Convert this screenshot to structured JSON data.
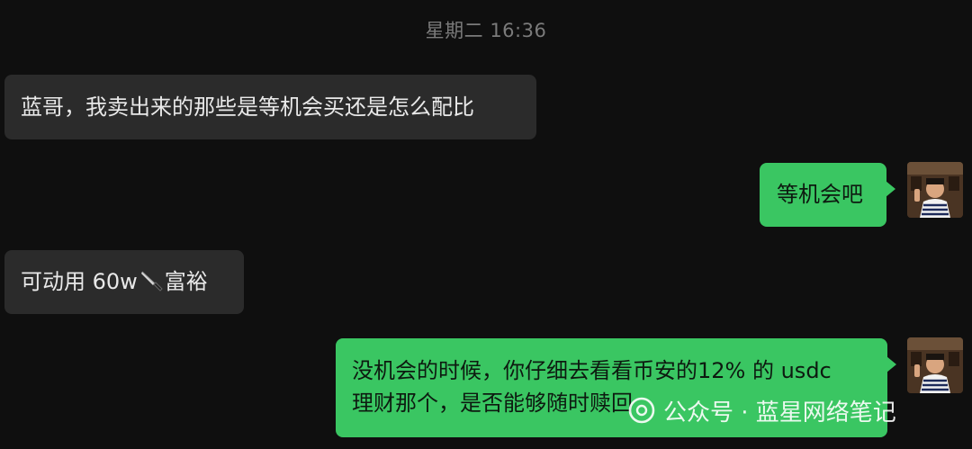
{
  "chat": {
    "timestamp": "星期二 16:36",
    "messages": [
      {
        "side": "left",
        "text": "蓝哥，我卖出来的那些是等机会买还是怎么配比"
      },
      {
        "side": "right",
        "text": "等机会吧"
      },
      {
        "side": "left",
        "text_before": "可动用 60w",
        "icon": "knife-icon",
        "text_after": "富裕"
      },
      {
        "side": "right",
        "line1": "没机会的时候，你仔细去看看币安的12% 的 usdc",
        "line2": "理财那个，是否能够随时赎回"
      }
    ]
  },
  "watermark": {
    "text": "公众号 · 蓝星网络笔记",
    "icon": "wechat-official-account-icon"
  },
  "colors": {
    "background": "#0f0f0f",
    "incoming_bubble": "#2b2b2b",
    "outgoing_bubble": "#3ac662",
    "timestamp": "#7b7b7b"
  }
}
